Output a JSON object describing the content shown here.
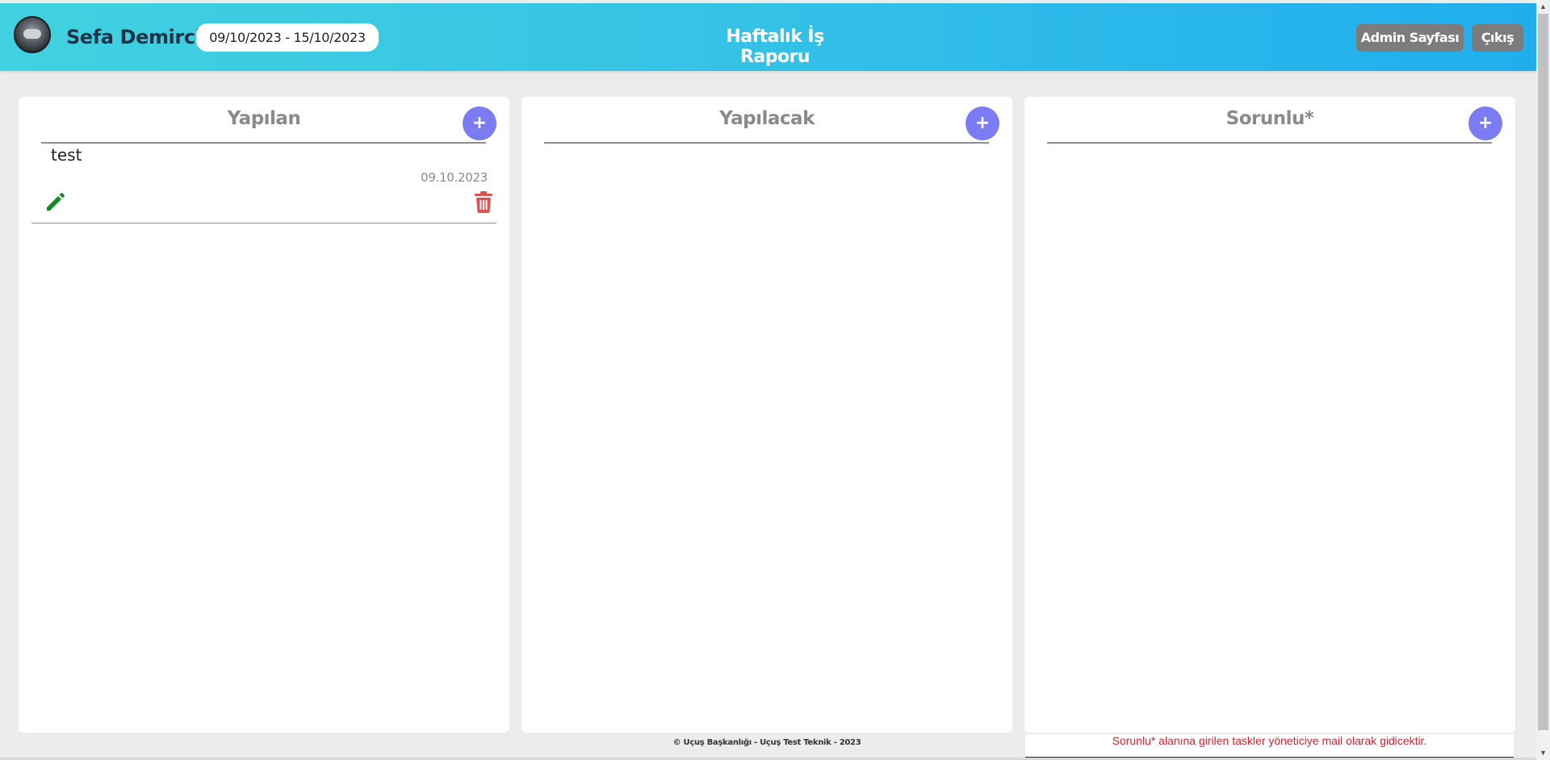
{
  "header": {
    "user_name": "Sefa Demirci",
    "date_range": "09/10/2023 - 15/10/2023",
    "title": "Haftalık İş Raporu",
    "admin_button": "Admin Sayfası",
    "exit_button": "Çıkış",
    "gradient_colors": [
      "#40d2e0",
      "#20aeef"
    ]
  },
  "columns": [
    {
      "title": "Yapılan",
      "add_label": "+",
      "tasks": [
        {
          "title": "test",
          "date": "09.10.2023",
          "edit_icon": "pencil-icon",
          "delete_icon": "trash-icon"
        }
      ]
    },
    {
      "title": "Yapılacak",
      "add_label": "+",
      "tasks": []
    },
    {
      "title": "Sorunlu*",
      "add_label": "+",
      "tasks": []
    }
  ],
  "footer": {
    "copyright": "© Uçuş Başkanlığı - Uçuş Test Teknik - 2023",
    "note": "Sorunlu* alanına girilen taskler yöneticiye mail olarak gidicektir."
  },
  "colors": {
    "accent_button": "#7b7bf4",
    "edit": "#178a23",
    "delete": "#e05252",
    "note": "#e0202a"
  }
}
